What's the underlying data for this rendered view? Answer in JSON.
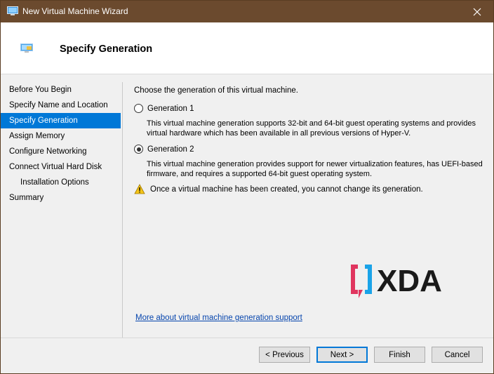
{
  "window": {
    "title": "New Virtual Machine Wizard"
  },
  "header": {
    "title": "Specify Generation"
  },
  "nav": {
    "items": [
      {
        "label": "Before You Begin"
      },
      {
        "label": "Specify Name and Location"
      },
      {
        "label": "Specify Generation",
        "active": true
      },
      {
        "label": "Assign Memory"
      },
      {
        "label": "Configure Networking"
      },
      {
        "label": "Connect Virtual Hard Disk"
      },
      {
        "label": "Installation Options",
        "sub": true
      },
      {
        "label": "Summary"
      }
    ]
  },
  "content": {
    "intro": "Choose the generation of this virtual machine.",
    "gen1": {
      "label": "Generation 1",
      "checked": false,
      "description": "This virtual machine generation supports 32-bit and 64-bit guest operating systems and provides virtual hardware which has been available in all previous versions of Hyper-V."
    },
    "gen2": {
      "label": "Generation 2",
      "checked": true,
      "description": "This virtual machine generation provides support for newer virtualization features, has UEFI-based firmware, and requires a supported 64-bit guest operating system."
    },
    "warning": "Once a virtual machine has been created, you cannot change its generation.",
    "link": "More about virtual machine generation support"
  },
  "logo": {
    "text": "XDA"
  },
  "buttons": {
    "previous": "< Previous",
    "next": "Next >",
    "finish": "Finish",
    "cancel": "Cancel"
  },
  "colors": {
    "titlebar": "#6b4a2e",
    "accent": "#0078d7",
    "link": "#0645ad",
    "logo_pink": "#e0355f",
    "logo_blue": "#1aa3e8",
    "logo_text": "#1a1a1a"
  }
}
